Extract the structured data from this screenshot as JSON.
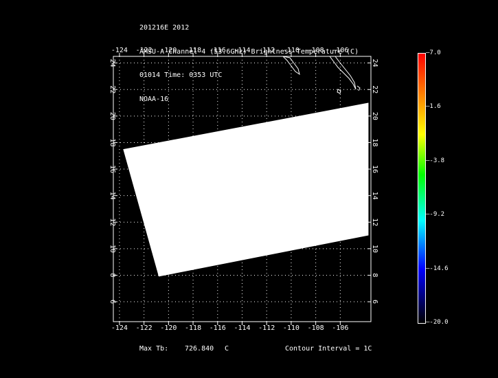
{
  "title_lines": [
    "201216E 2012",
    "AMSU-A Channel 4 (53.6GHz) Brightness Temperature (C)",
    "01014 Time: 0353 UTC",
    "NOAA-16"
  ],
  "lon_ticks": [
    "-124",
    "-122",
    "-120",
    "-118",
    "-116",
    "-114",
    "-112",
    "-110",
    "-108",
    "-106"
  ],
  "lat_ticks": [
    "6",
    "8",
    "10",
    "12",
    "14",
    "16",
    "18",
    "20",
    "22",
    "24"
  ],
  "map": {
    "lon_min": -124.5,
    "lon_max": -103.5,
    "lat_min": 4.5,
    "lat_max": 24.5
  },
  "colorbar": {
    "labels": [
      "7.0",
      "1.6",
      "-3.8",
      "-9.2",
      "-14.6",
      "-20.0"
    ],
    "max": 7.0,
    "min": -20.0
  },
  "footer": {
    "max_tb_label": "Max Tb:",
    "max_tb_value": "726.840",
    "max_tb_unit": "C",
    "contour": "Contour Interval = 1C"
  },
  "swath": {
    "corners": [
      {
        "lon": -123.7,
        "lat": 17.5
      },
      {
        "lon": -103.7,
        "lat": 21.0
      },
      {
        "lon": -103.7,
        "lat": 11.0
      },
      {
        "lon": -120.8,
        "lat": 7.9
      }
    ]
  },
  "colors": {
    "background": "#000000",
    "grid": "#ffffff",
    "swath": "#ffffff",
    "coast": "#ffffff"
  }
}
